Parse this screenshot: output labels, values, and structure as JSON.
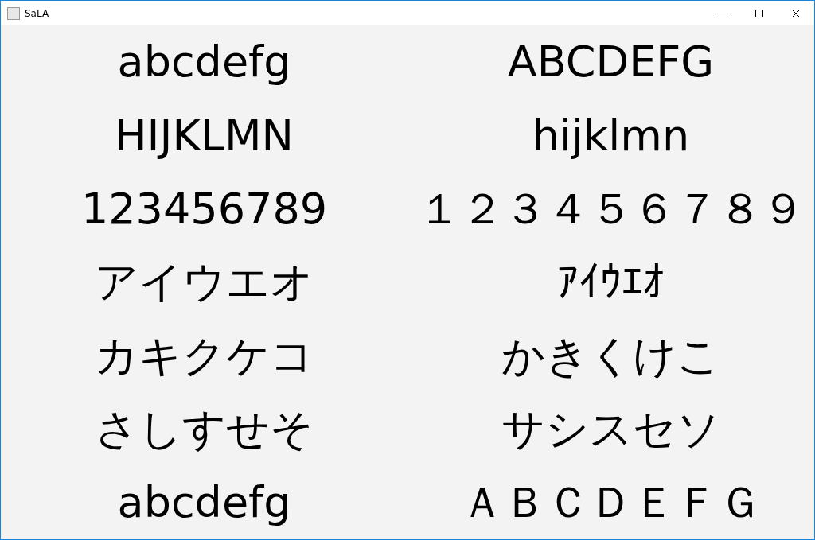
{
  "window": {
    "title": "SaLA"
  },
  "cells": [
    {
      "text": "abcdefg"
    },
    {
      "text": "ABCDEFG"
    },
    {
      "text": "HIJKLMN"
    },
    {
      "text": "hijklmn"
    },
    {
      "text": "123456789"
    },
    {
      "text": "１２３４５６７８９"
    },
    {
      "text": "アイウエオ"
    },
    {
      "text": "ｱｲｳｴｵ"
    },
    {
      "text": "カキクケコ"
    },
    {
      "text": "かきくけこ"
    },
    {
      "text": "さしすせそ"
    },
    {
      "text": "サシスセソ"
    },
    {
      "text": "abcdefg"
    },
    {
      "text": "ＡＢＣＤＥＦＧ"
    }
  ]
}
